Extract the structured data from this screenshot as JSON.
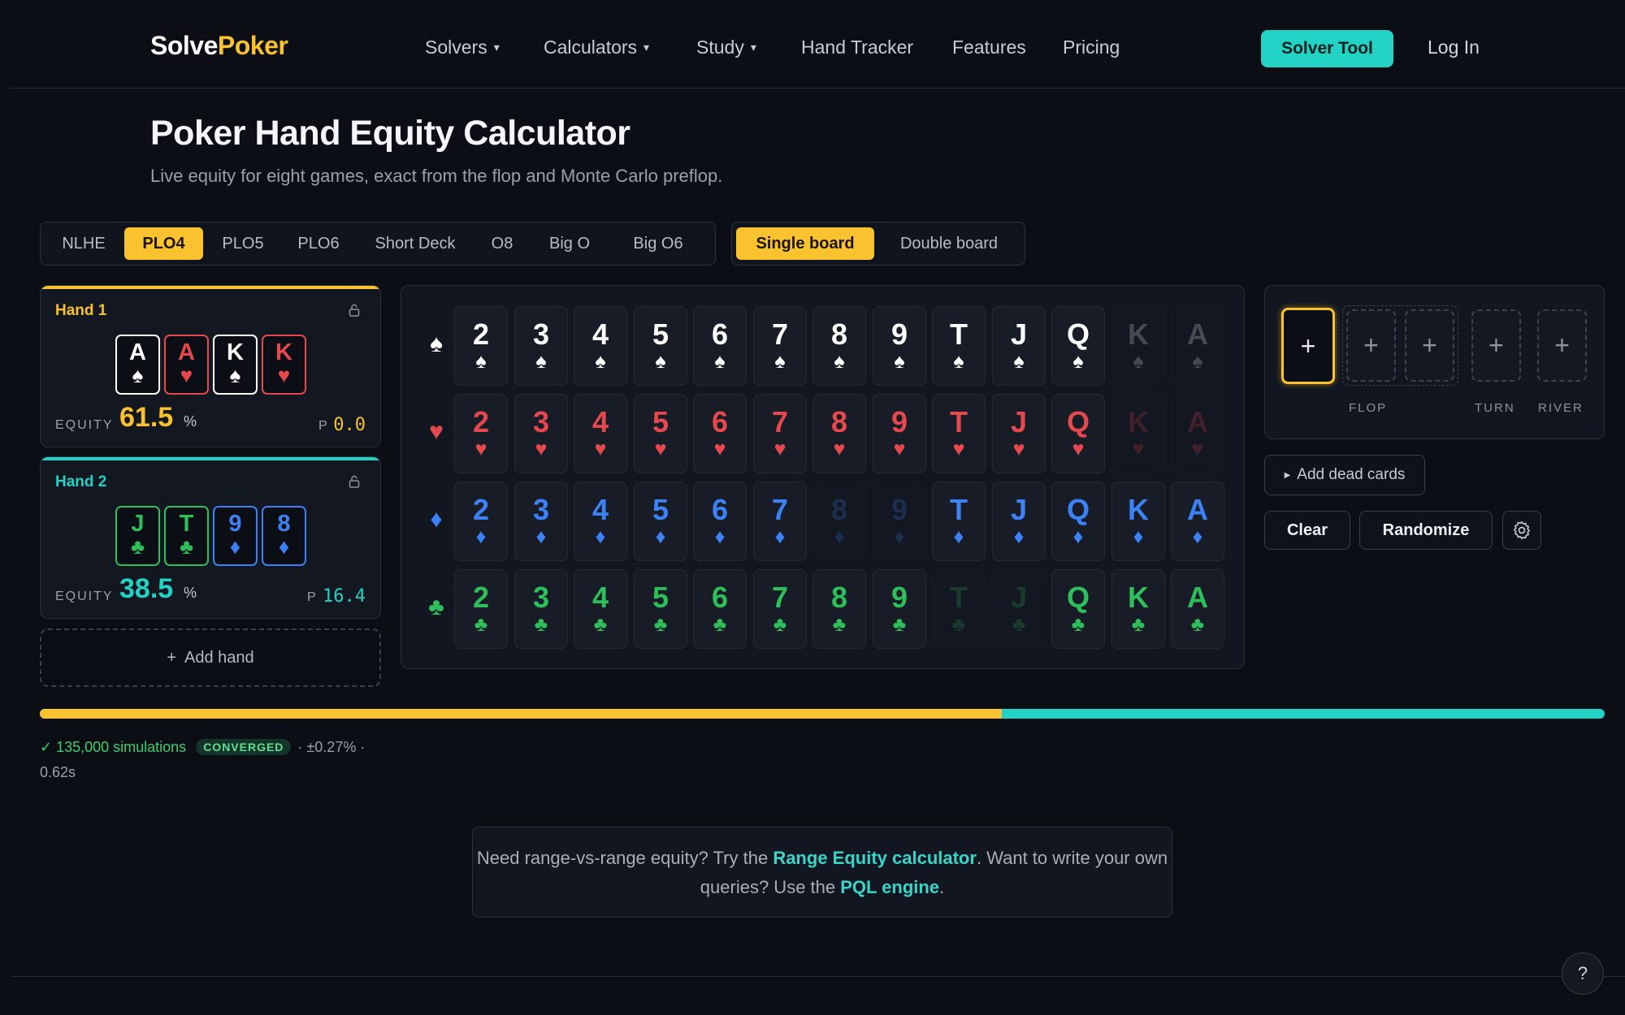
{
  "nav": {
    "logo_a": "Solve",
    "logo_b": "Poker",
    "links": [
      "Solvers",
      "Calculators",
      "Study",
      "Hand Tracker",
      "Features",
      "Pricing"
    ],
    "solver_tool": "Solver Tool",
    "login": "Log In"
  },
  "header": {
    "title": "Poker Hand Equity Calculator",
    "subtitle": "Live equity for eight games, exact from the flop and Monte Carlo preflop."
  },
  "games": {
    "tabs": [
      "NLHE",
      "PLO4",
      "PLO5",
      "PLO6",
      "Short Deck",
      "O8",
      "Big O",
      "Big O6"
    ],
    "active": "PLO4"
  },
  "board_mode": {
    "tabs": [
      "Single board",
      "Double board"
    ],
    "active": "Single board"
  },
  "hands": [
    {
      "title": "Hand 1",
      "color": "#f9c22e",
      "cards": [
        [
          "A",
          "♠",
          "#ffffff"
        ],
        [
          "A",
          "♥",
          "#e5484d"
        ],
        [
          "K",
          "♠",
          "#ffffff"
        ],
        [
          "K",
          "♥",
          "#e5484d"
        ]
      ],
      "equity_label": "EQUITY",
      "equity": "61.5",
      "pct": "%",
      "p_label": "P",
      "p_val": "0.0"
    },
    {
      "title": "Hand 2",
      "color": "#22d3c5",
      "cards": [
        [
          "J",
          "♣",
          "#2fbf5a"
        ],
        [
          "T",
          "♣",
          "#2fbf5a"
        ],
        [
          "9",
          "♦",
          "#3b82f6"
        ],
        [
          "8",
          "♦",
          "#3b82f6"
        ]
      ],
      "equity_label": "EQUITY",
      "equity": "38.5",
      "pct": "%",
      "p_label": "P",
      "p_val": "16.4"
    }
  ],
  "add_hand": "Add hand",
  "deck": {
    "ranks": [
      "2",
      "3",
      "4",
      "5",
      "6",
      "7",
      "8",
      "9",
      "T",
      "J",
      "Q",
      "K",
      "A"
    ],
    "suits": [
      {
        "sym": "♠",
        "color": "#ffffff",
        "used": [
          "K",
          "A"
        ]
      },
      {
        "sym": "♥",
        "color": "#e5484d",
        "used": [
          "K",
          "A"
        ]
      },
      {
        "sym": "♦",
        "color": "#3b82f6",
        "used": [
          "8",
          "9"
        ]
      },
      {
        "sym": "♣",
        "color": "#2fbf5a",
        "used": [
          "T",
          "J"
        ]
      }
    ]
  },
  "board": {
    "slot_symbol": "+",
    "labels": {
      "flop": "FLOP",
      "turn": "TURN",
      "river": "RIVER"
    }
  },
  "buttons": {
    "dead_cards": "Add dead cards",
    "clear": "Clear",
    "randomize": "Randomize"
  },
  "progress": {
    "hand1_fraction": 0.615,
    "hand1_color": "#f9c22e",
    "hand2_color": "#22d3c5"
  },
  "stats": {
    "simulations": "✓ 135,000 simulations",
    "badge": "CONVERGED",
    "error": "· ±0.27% ·",
    "time": "0.62s"
  },
  "callout": {
    "t1": "Need range-vs-range equity? Try the ",
    "link1": "Range Equity calculator",
    "t2": ". Want to write your own queries? Use the ",
    "link2": "PQL engine",
    "t3": "."
  },
  "help": "?"
}
